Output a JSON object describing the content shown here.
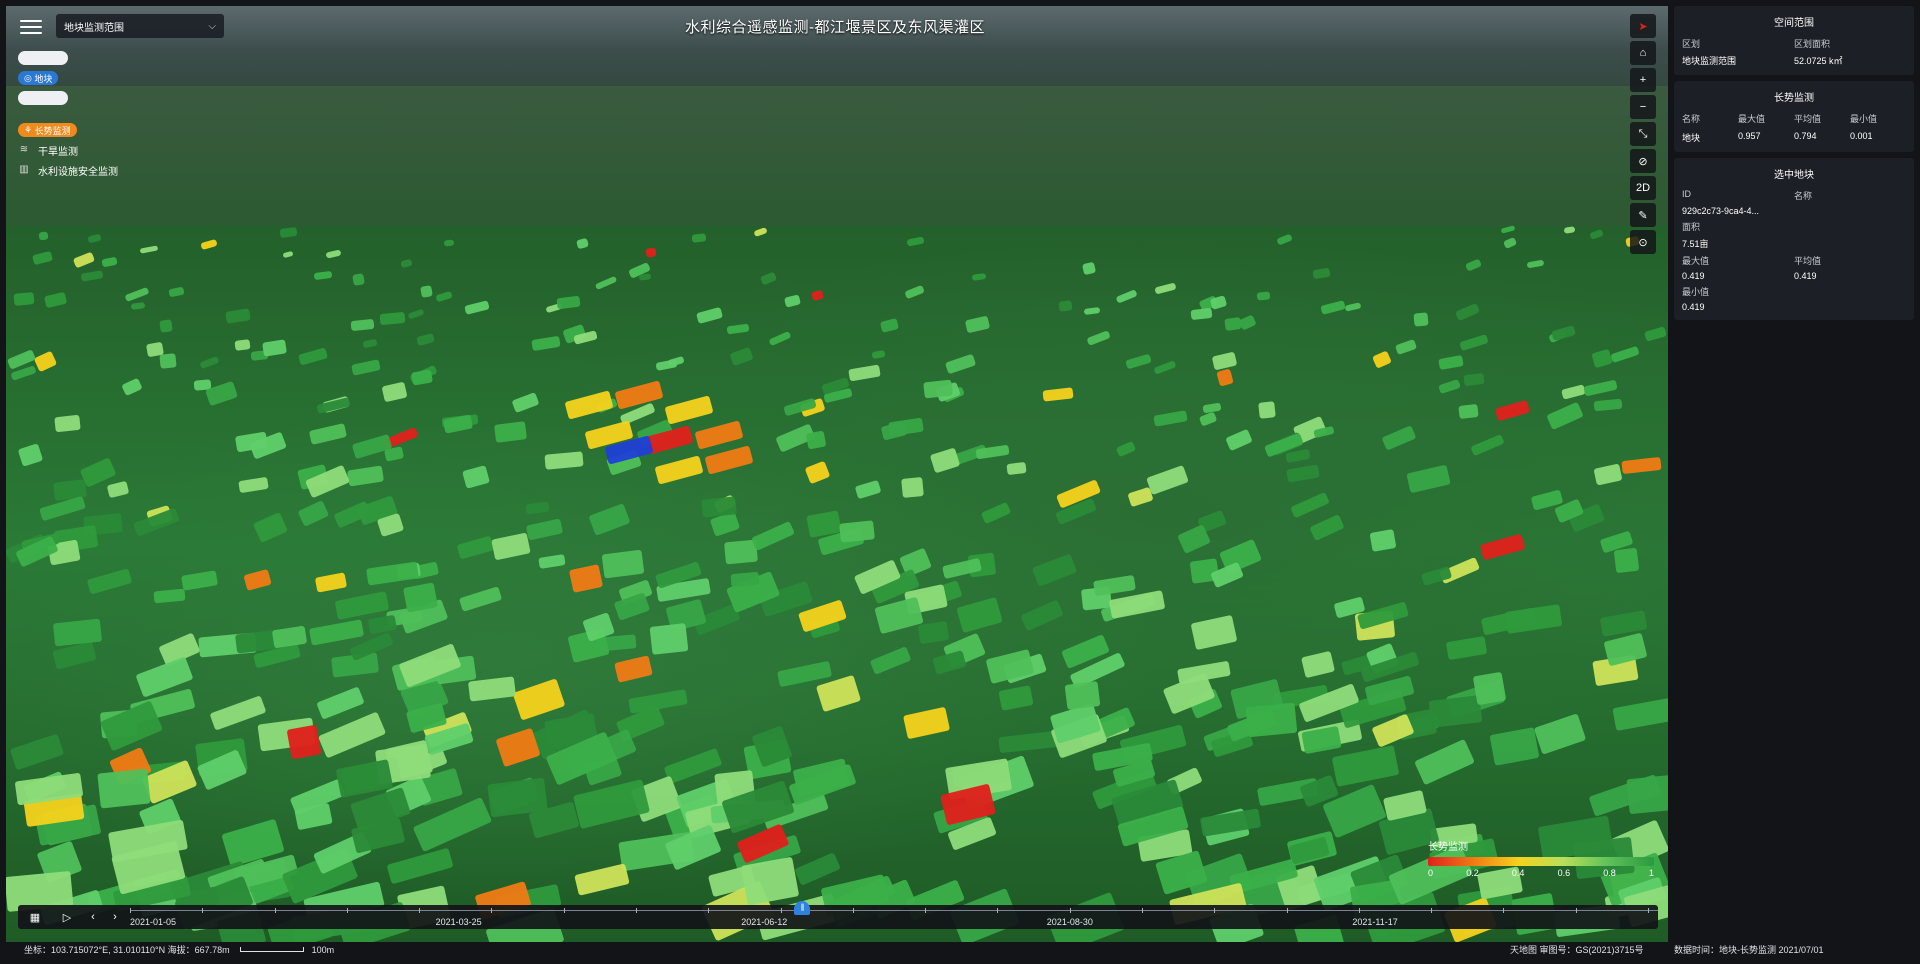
{
  "header": {
    "title": "水利综合遥感监测-都江堰景区及东风渠灌区",
    "menu_icon": "hamburger-menu-icon",
    "scope_select": "地块监测范围"
  },
  "layers": [
    {
      "label": "",
      "style": "white-pill"
    },
    {
      "label": "地块",
      "style": "blue-pill"
    },
    {
      "label": "",
      "style": "white-pill"
    },
    {
      "label": "长势监测",
      "style": "orange-pill",
      "icon": "growth-icon"
    },
    {
      "label": "干旱监测",
      "icon": "drought-icon"
    },
    {
      "label": "水利设施安全监测",
      "icon": "facility-icon"
    }
  ],
  "toolbar": {
    "compass_icon": "compass-icon",
    "home_icon": "home-icon",
    "zoom_in": "+",
    "zoom_out": "−",
    "fullscreen_icon": "fullscreen-icon",
    "hide_icon": "eye-off-icon",
    "mode_label": "2D",
    "measure_icon": "ruler-icon",
    "locate_icon": "locate-icon"
  },
  "panel": {
    "spatial": {
      "title": "空间范围",
      "col1": "区划",
      "col2": "区划面积",
      "name": "地块监测范围",
      "area": "52.0725 k㎡"
    },
    "growth": {
      "title": "长势监测",
      "headers": [
        "名称",
        "最大值",
        "平均值",
        "最小值"
      ],
      "row": [
        "地块",
        "0.957",
        "0.794",
        "0.001"
      ]
    },
    "selected": {
      "title": "选中地块",
      "id_label": "ID",
      "name_label": "名称",
      "id_value": "929c2c73-9ca4-4...",
      "area_label": "面积",
      "area_value": "7.51亩",
      "max_label": "最大值",
      "avg_label": "平均值",
      "max_value": "0.419",
      "avg_value": "0.419",
      "min_label": "最小值",
      "min_value": "0.419"
    }
  },
  "legend": {
    "title": "长势监测",
    "ticks": [
      "0",
      "0.2",
      "0.4",
      "0.6",
      "0.8",
      "1"
    ],
    "colors": [
      "#e0201b",
      "#f07a14",
      "#f6d21c",
      "#b7e05a",
      "#5fc05a",
      "#2a9a40"
    ]
  },
  "timeline": {
    "calendar_icon": "calendar-icon",
    "play_icon": "play-icon",
    "prev": "‹",
    "next": "›",
    "dates": [
      "2021-01-05",
      "2021-03-25",
      "2021-06-12",
      "2021-08-30",
      "2021-11-17"
    ],
    "current_position": 0.44
  },
  "status": {
    "coords": "坐标：103.715072°E, 31.010110°N  海拔：667.78m",
    "scale": "100m",
    "attribution": "天地图 审图号：GS(2021)3715号",
    "data_time": "数据时间：地块-长势监测 2021/07/01"
  }
}
